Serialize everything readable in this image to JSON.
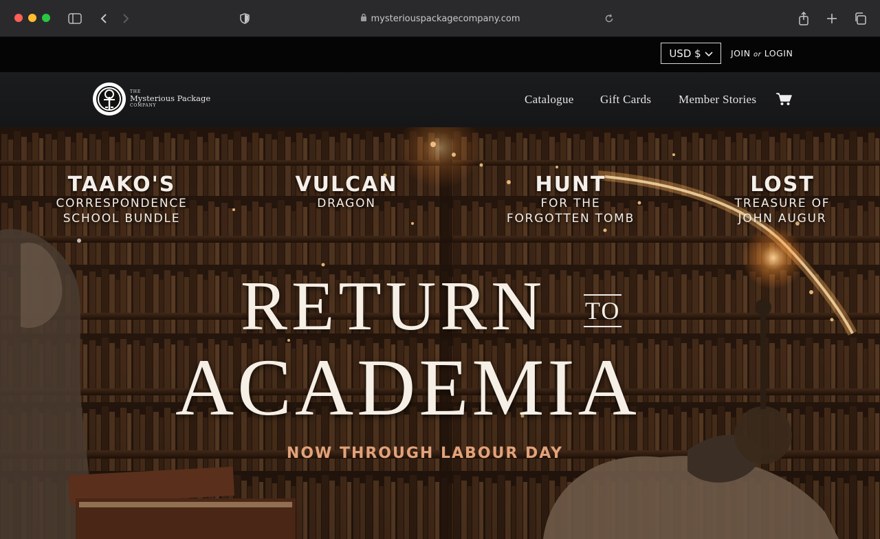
{
  "browser": {
    "url": "mysteriouspackagecompany.com"
  },
  "topbar": {
    "currency": "USD $",
    "join": "JOIN",
    "or": "or",
    "login": "LOGIN"
  },
  "logo": {
    "line1": "THE",
    "line2": "Mysterious Package",
    "line3": "COMPANY"
  },
  "nav": {
    "items": [
      {
        "label": "Catalogue"
      },
      {
        "label": "Gift Cards"
      },
      {
        "label": "Member Stories"
      }
    ]
  },
  "hero": {
    "promos": [
      {
        "title": "TAAKO'S",
        "line1": "CORRESPONDENCE",
        "line2": "SCHOOL BUNDLE"
      },
      {
        "title": "VULCAN",
        "line1": "DRAGON",
        "line2": ""
      },
      {
        "title": "HUNT",
        "line1": "FOR THE",
        "line2": "FORGOTTEN TOMB"
      },
      {
        "title": "LOST",
        "line1": "TREASURE OF",
        "line2": "JOHN AUGUR"
      }
    ],
    "title_word1": "RETURN",
    "title_to": "TO",
    "title_word2": "ACADEMIA",
    "tagline": "NOW THROUGH LABOUR DAY"
  },
  "colors": {
    "tagline": "#e2a27a",
    "topbar": "#050505",
    "navbar": "#1b1c1e"
  }
}
